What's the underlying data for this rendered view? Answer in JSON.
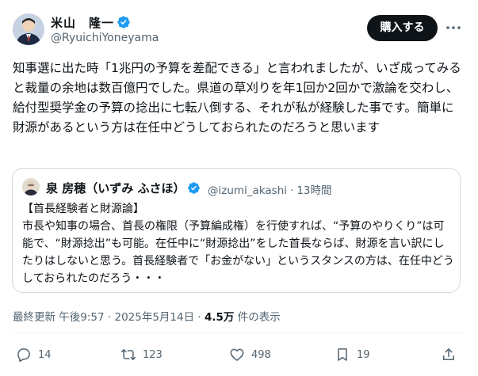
{
  "author": {
    "name": "米山　隆一",
    "handle": "@RyuichiYoneyama"
  },
  "subscribe_label": "購入する",
  "tweet": {
    "text": "知事選に出た時「1兆円の予算を差配できる」と言われましたが、いざ成ってみると裁量の余地は数百億円でした。県道の草刈りを年1回か2回かで激論を交わし、給付型奨学金の予算の捻出に七転八倒する、それが私が経験した事です。簡単に財源があるという方は在任中どうしておられたのだろうと思います"
  },
  "quote": {
    "author_name": "泉 房穂（いずみ ふさほ）",
    "handle": "@izumi_akashi",
    "separator": "·",
    "time": "13時間",
    "body": "【首長経験者と財源論】\n市長や知事の場合、首長の権限（予算編成権）を行使すれば、“予算のやりくり”は可能で、“財源捻出”も可能。在任中に“財源捻出”をした首長ならば、財源を言い訳にしたりはしないと思う。首長経験者で「お金がない」というスタンスの方は、在任中どうしておられたのだろう・・・"
  },
  "meta": {
    "updated_label": "最終更新 午後9:57 · 2025年5月14日 · ",
    "views_count": "4.5万",
    "views_suffix": " 件の表示"
  },
  "actions": {
    "replies": "14",
    "reposts": "123",
    "likes": "498",
    "bookmarks": "19"
  },
  "colors": {
    "text": "#0f1419",
    "secondary": "#536471",
    "verified": "#1d9bf0",
    "border": "#cfd9de"
  }
}
